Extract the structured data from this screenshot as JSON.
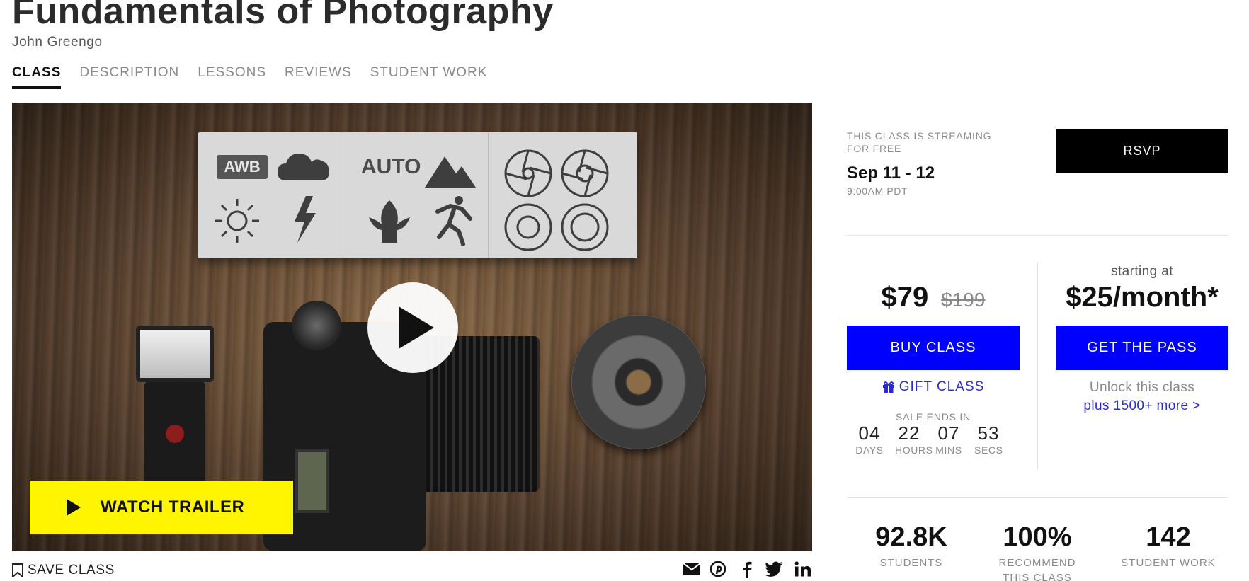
{
  "course": {
    "title": "Fundamentals of Photography",
    "instructor": "John Greengo"
  },
  "tabs": [
    {
      "label": "CLASS",
      "active": true
    },
    {
      "label": "DESCRIPTION",
      "active": false
    },
    {
      "label": "LESSONS",
      "active": false
    },
    {
      "label": "REVIEWS",
      "active": false
    },
    {
      "label": "STUDENT WORK",
      "active": false
    }
  ],
  "video": {
    "card_labels": {
      "awb": "AWB",
      "auto": "AUTO"
    },
    "trailer_label": "WATCH TRAILER"
  },
  "actions": {
    "save_label": "SAVE CLASS"
  },
  "share_icons": [
    "envelope-icon",
    "pinterest-icon",
    "facebook-icon",
    "twitter-icon",
    "linkedin-icon"
  ],
  "stream": {
    "note": "THIS CLASS IS STREAMING FOR FREE",
    "dates": "Sep 11 - 12",
    "time": "9:00AM PDT",
    "rsvp_label": "RSVP"
  },
  "purchase": {
    "price": "$79",
    "original_price": "$199",
    "buy_label": "BUY CLASS",
    "gift_label": "GIFT CLASS",
    "sale_label": "SALE ENDS IN",
    "countdown": [
      {
        "value": "04",
        "unit": "DAYS"
      },
      {
        "value": "22",
        "unit": "HOURS"
      },
      {
        "value": "07",
        "unit": "MINS"
      },
      {
        "value": "53",
        "unit": "SECS"
      }
    ]
  },
  "pass": {
    "starting_label": "starting at",
    "price": "$25/month*",
    "button_label": "GET THE PASS",
    "unlock_text": "Unlock this class",
    "more_link": "plus 1500+ more >"
  },
  "stats": [
    {
      "value": "92.8K",
      "label": "STUDENTS"
    },
    {
      "value": "100%",
      "label": "RECOMMEND THIS CLASS"
    },
    {
      "value": "142",
      "label": "STUDENT WORK"
    }
  ],
  "colors": {
    "blue_button": "#0000ff",
    "link_blue": "#2b2bd6",
    "trailer_yellow": "#fff500",
    "rsvp_black": "#000000"
  }
}
